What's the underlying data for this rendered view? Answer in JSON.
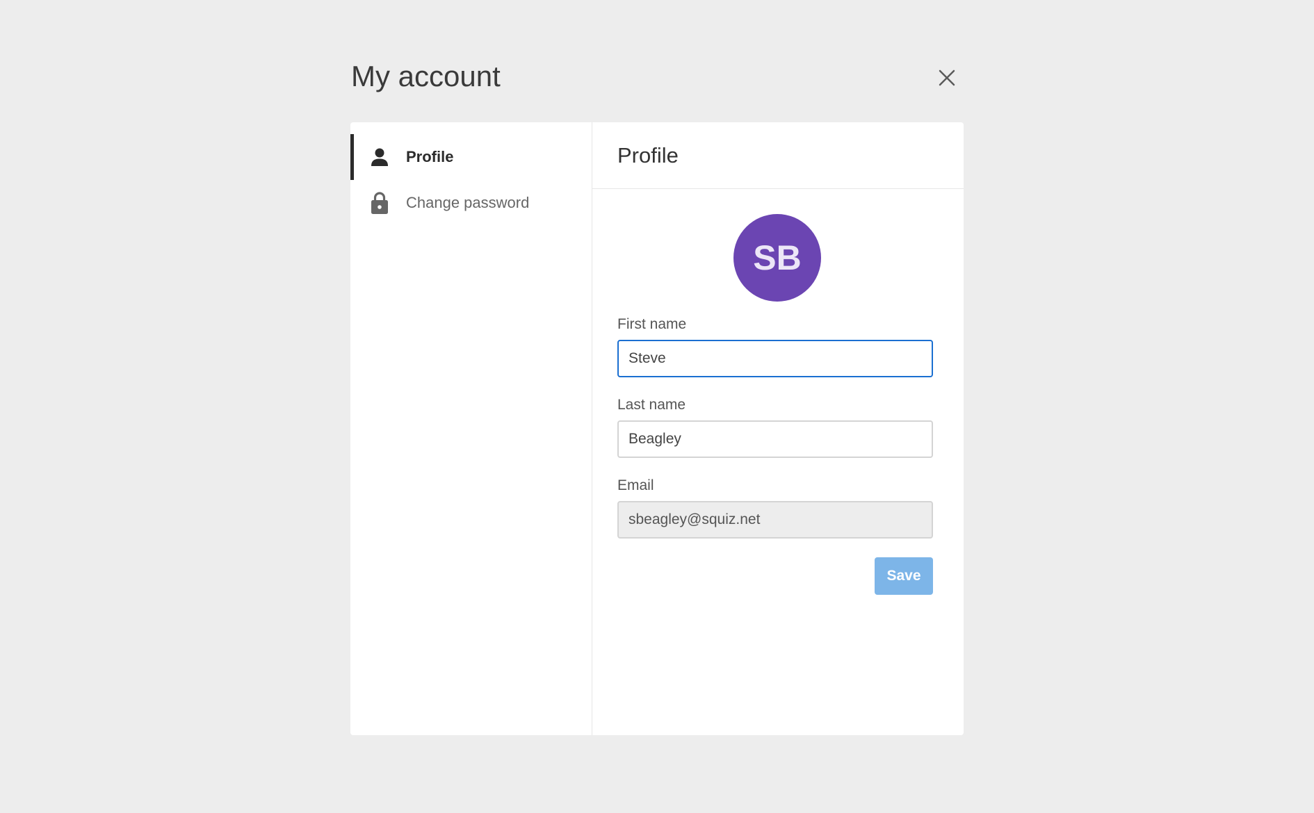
{
  "dialog": {
    "title": "My account",
    "close_icon": "close-icon"
  },
  "sidebar": {
    "items": [
      {
        "label": "Profile",
        "icon": "person-icon",
        "active": true
      },
      {
        "label": "Change password",
        "icon": "lock-icon",
        "active": false
      }
    ]
  },
  "profile": {
    "title": "Profile",
    "avatar": {
      "initials": "SB",
      "color": "#6b45b2"
    },
    "fields": {
      "first_name": {
        "label": "First name",
        "value": "Steve"
      },
      "last_name": {
        "label": "Last name",
        "value": "Beagley"
      },
      "email": {
        "label": "Email",
        "value": "sbeagley@squiz.net"
      }
    },
    "save_label": "Save"
  },
  "colors": {
    "focus_border": "#1a6fd1",
    "save_button": "#7db5e8",
    "page_background": "#ededed"
  }
}
